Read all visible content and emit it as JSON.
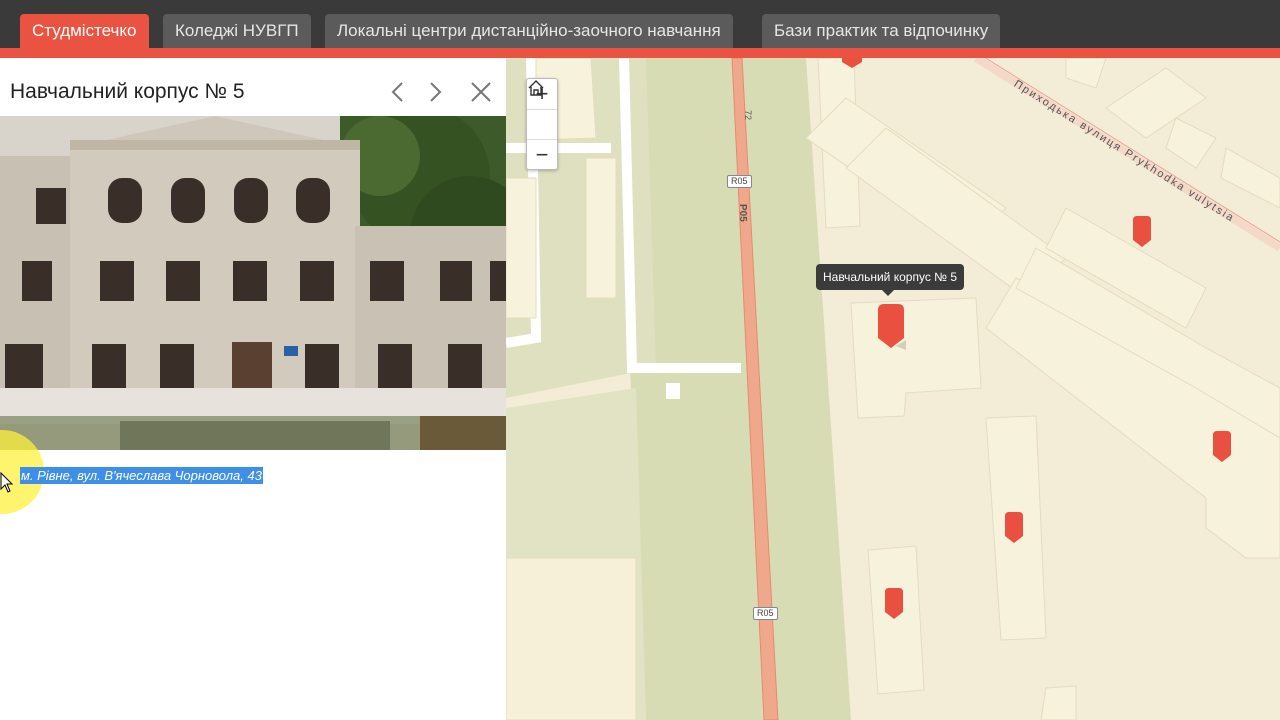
{
  "tabs": [
    {
      "label": "Студмістечко",
      "active": true
    },
    {
      "label": "Коледжі НУВГП",
      "active": false
    },
    {
      "label": "Локальні центри дистанційно-заочного навчання",
      "active": false
    },
    {
      "label": "Бази практик та відпочинку",
      "active": false
    }
  ],
  "panel": {
    "title": "Навчальний корпус № 5",
    "prev_icon": "chevron-left-icon",
    "next_icon": "chevron-right-icon",
    "close_icon": "close-icon",
    "address": "м. Рівне, вул. В'ячеслава Чорновола, 43"
  },
  "map": {
    "zoom_in": "+",
    "home_icon": "home-icon",
    "zoom_out": "−",
    "tooltip": "Навчальний корпус № 5",
    "road_badge": "R05",
    "road_name": "P05",
    "road_number": "72",
    "street_name": "Приходька вулиця  Prykhodka vulytsia"
  },
  "colors": {
    "accent": "#ea5241",
    "topbar": "#3a3a3a",
    "tab": "#5b5b5b"
  }
}
